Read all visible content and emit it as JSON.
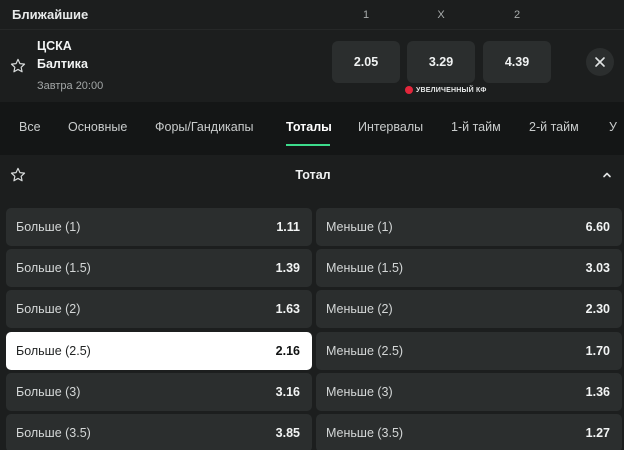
{
  "header": {
    "title": "Ближайшие",
    "cols": [
      "1",
      "X",
      "2"
    ]
  },
  "event": {
    "team1": "ЦСКА",
    "team2": "Балтика",
    "time": "Завтра 20:00",
    "odds": [
      "2.05",
      "3.29",
      "4.39"
    ],
    "boost_label": "УВЕЛИЧЕННЫЙ КФ"
  },
  "tabs": [
    {
      "label": "Все"
    },
    {
      "label": "Основные"
    },
    {
      "label": "Форы/Гандикапы"
    },
    {
      "label": "Тоталы",
      "active": true
    },
    {
      "label": "Интервалы"
    },
    {
      "label": "1-й тайм"
    },
    {
      "label": "2-й тайм"
    },
    {
      "label": "У"
    }
  ],
  "market": {
    "title": "Тотал",
    "rows": [
      {
        "over_label": "Больше (1)",
        "over_odd": "1.11",
        "under_label": "Меньше (1)",
        "under_odd": "6.60"
      },
      {
        "over_label": "Больше (1.5)",
        "over_odd": "1.39",
        "under_label": "Меньше (1.5)",
        "under_odd": "3.03"
      },
      {
        "over_label": "Больше (2)",
        "over_odd": "1.63",
        "under_label": "Меньше (2)",
        "under_odd": "2.30"
      },
      {
        "over_label": "Больше (2.5)",
        "over_odd": "2.16",
        "under_label": "Меньше (2.5)",
        "under_odd": "1.70"
      },
      {
        "over_label": "Больше (3)",
        "over_odd": "3.16",
        "under_label": "Меньше (3)",
        "under_odd": "1.36"
      },
      {
        "over_label": "Больше (3.5)",
        "over_odd": "3.85",
        "under_label": "Меньше (3.5)",
        "under_odd": "1.27"
      }
    ],
    "selected": "Больше (2.5)"
  },
  "colors": {
    "accent": "#3ddc8c",
    "boost": "#e3263b",
    "background": "#141616",
    "panel": "#1c1e1e",
    "button": "#2b2e2e"
  }
}
